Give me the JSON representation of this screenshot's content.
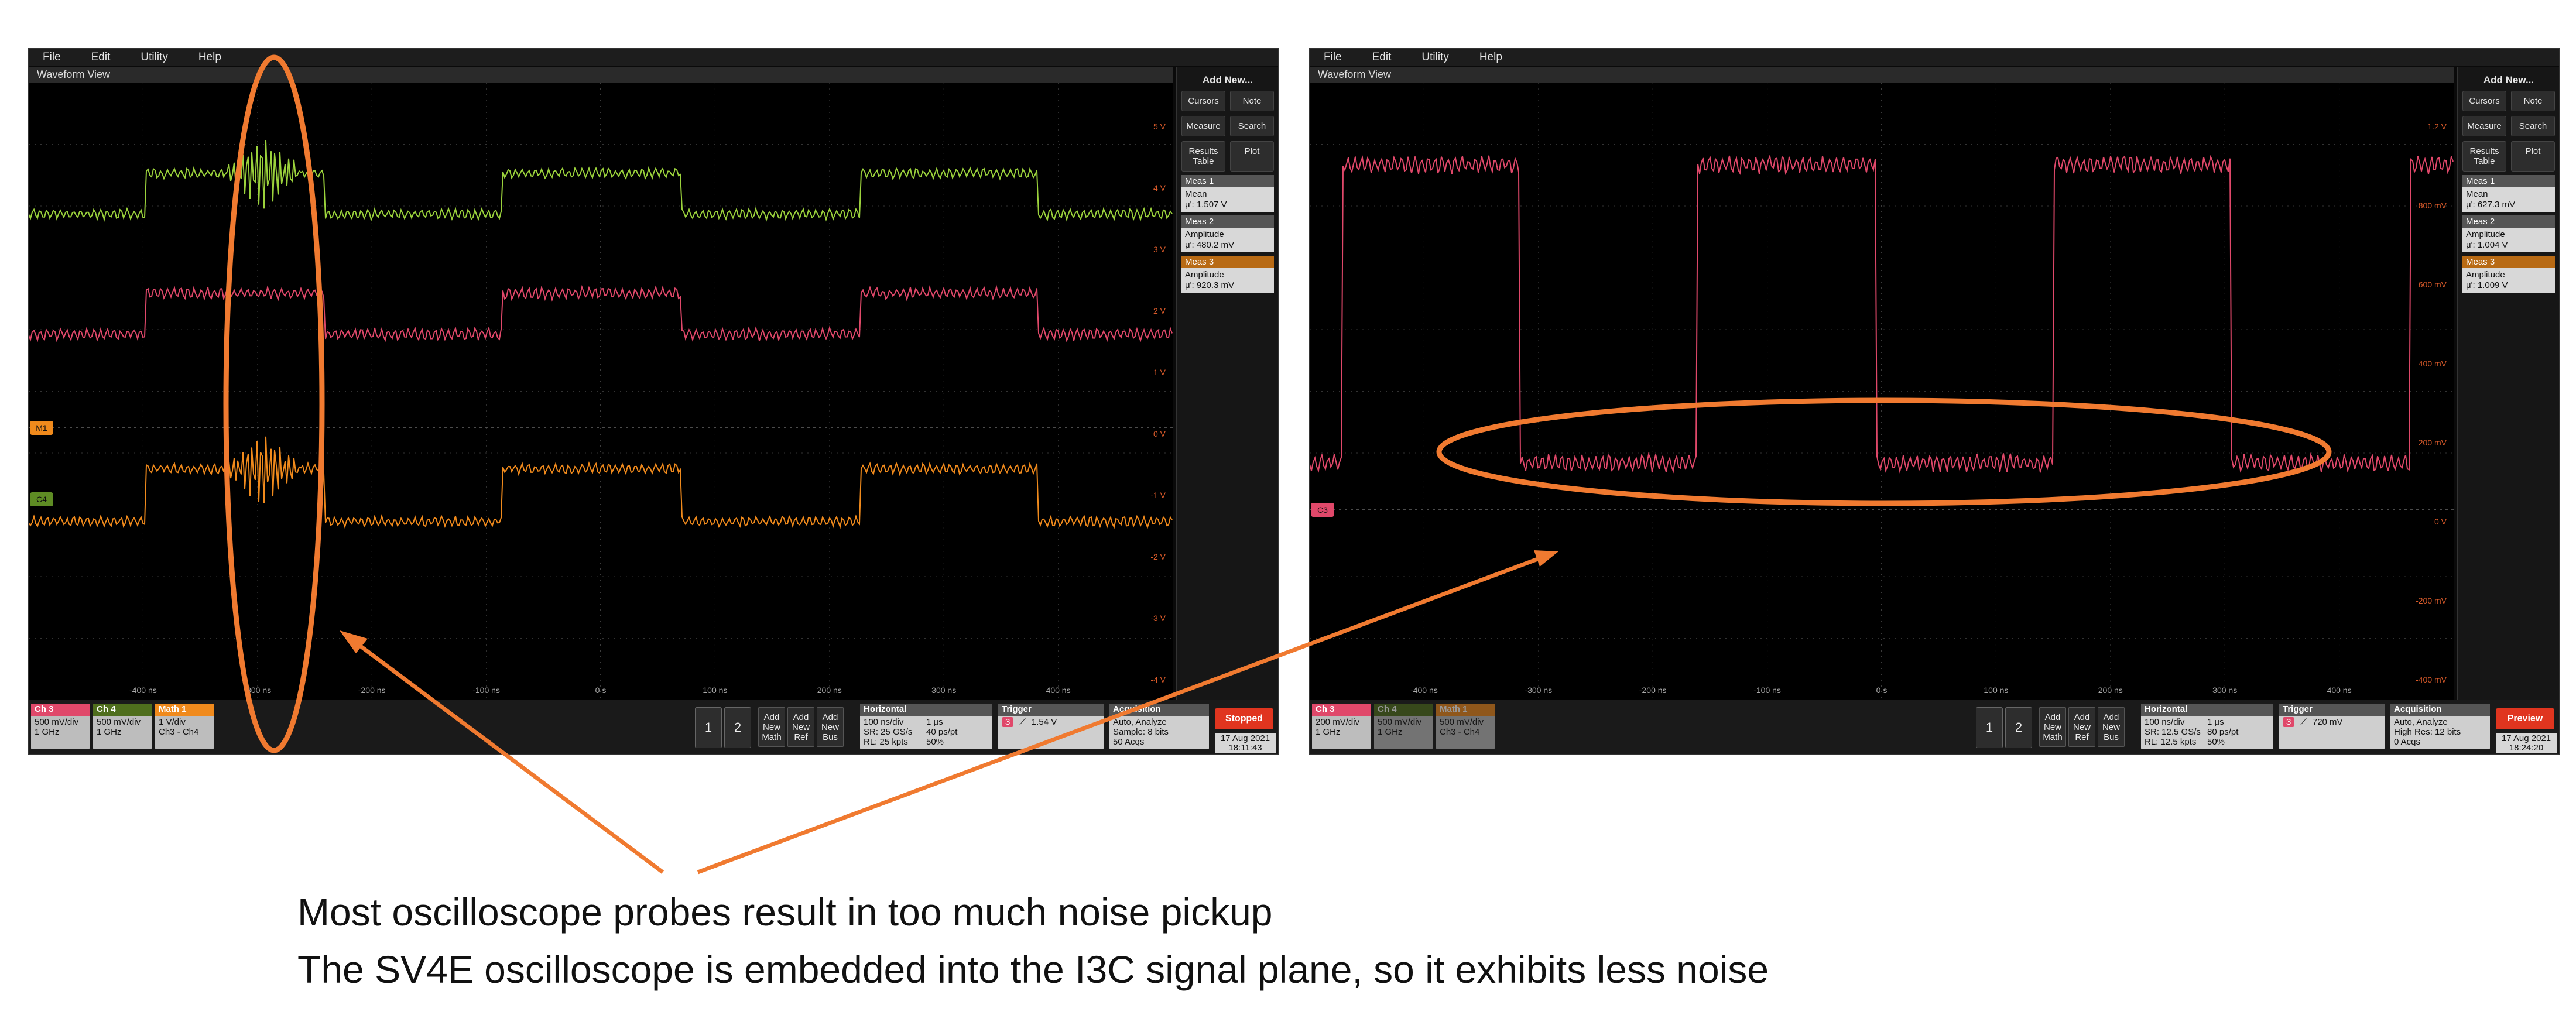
{
  "menu": [
    "File",
    "Edit",
    "Utility",
    "Help"
  ],
  "waveform_view_title": "Waveform View",
  "side_panel": {
    "title": "Add New...",
    "buttons": [
      "Cursors",
      "Note",
      "Measure",
      "Search",
      "Results Table",
      "Plot"
    ]
  },
  "left_scope": {
    "measurements": [
      {
        "header": "Meas 1",
        "name": "Mean",
        "value": "μ': 1.507 V"
      },
      {
        "header": "Meas 2",
        "name": "Amplitude",
        "value": "μ': 480.2 mV"
      },
      {
        "header": "Meas 3",
        "name": "Amplitude",
        "value": "μ': 920.3 mV"
      }
    ],
    "ylabels": [
      "5 V",
      "4 V",
      "3 V",
      "2 V",
      "1 V",
      "0 V",
      "-1 V",
      "-2 V",
      "-3 V",
      "-4 V"
    ],
    "xlabels": [
      "-400 ns",
      "-300 ns",
      "-200 ns",
      "-100 ns",
      "0 s",
      "100 ns",
      "200 ns",
      "300 ns",
      "400 ns"
    ],
    "channels": [
      {
        "name": "Ch 3",
        "l1": "500 mV/div",
        "l2": "1 GHz",
        "color": "#e0486a"
      },
      {
        "name": "Ch 4",
        "l1": "500 mV/div",
        "l2": "1 GHz",
        "color": "#9bd23c"
      },
      {
        "name": "Math 1",
        "l1": "1 V/div",
        "l2": "Ch3 - Ch4",
        "color": "#f08a1c"
      }
    ],
    "horizontal": {
      "title": "Horizontal",
      "a": "100 ns/div",
      "b": "1 µs",
      "c": "SR: 25 GS/s",
      "d": "40 ps/pt",
      "e": "RL: 25 kpts",
      "f": "50%"
    },
    "trigger": {
      "title": "Trigger",
      "ch": "3",
      "level": "1.54 V"
    },
    "acquisition": {
      "title": "Acquisition",
      "a": "Auto,",
      "b": "Analyze",
      "c": "Sample: 8 bits",
      "d": "50 Acqs"
    },
    "run_state": "Stopped",
    "date": "17 Aug 2021",
    "time": "18:11:43",
    "markers": {
      "m": "M1",
      "c": "C4"
    }
  },
  "right_scope": {
    "measurements": [
      {
        "header": "Meas 1",
        "name": "Mean",
        "value": "μ': 627.3 mV"
      },
      {
        "header": "Meas 2",
        "name": "Amplitude",
        "value": "μ': 1.004 V"
      },
      {
        "header": "Meas 3",
        "name": "Amplitude",
        "value": "μ': 1.009 V"
      }
    ],
    "ylabels": [
      "1.2 V",
      "800 mV",
      "600 mV",
      "400 mV",
      "200 mV",
      "0 V",
      "-200 mV",
      "-400 mV"
    ],
    "xlabels": [
      "-400 ns",
      "-300 ns",
      "-200 ns",
      "-100 ns",
      "0 s",
      "100 ns",
      "200 ns",
      "300 ns",
      "400 ns"
    ],
    "channels": [
      {
        "name": "Ch 3",
        "l1": "200 mV/div",
        "l2": "1 GHz",
        "color": "#e0486a"
      },
      {
        "name": "Ch 4",
        "l1": "500 mV/div",
        "l2": "1 GHz",
        "color": "#9bd23c"
      },
      {
        "name": "Math 1",
        "l1": "500 mV/div",
        "l2": "Ch3 - Ch4",
        "color": "#f08a1c"
      }
    ],
    "horizontal": {
      "title": "Horizontal",
      "a": "100 ns/div",
      "b": "1 µs",
      "c": "SR: 12.5 GS/s",
      "d": "80 ps/pt",
      "e": "RL: 12.5 kpts",
      "f": "50%"
    },
    "trigger": {
      "title": "Trigger",
      "ch": "3",
      "level": "720 mV"
    },
    "acquisition": {
      "title": "Acquisition",
      "a": "Auto,",
      "b": "Analyze",
      "c": "High Res: 12 bits",
      "d": "0 Acqs"
    },
    "run_state": "Preview",
    "date": "17 Aug 2021",
    "time": "18:24:20",
    "markers": {
      "c": "C3"
    }
  },
  "bottom_buttons": {
    "one": "1",
    "two": "2",
    "add_math": "Add New Math",
    "add_ref": "Add New Ref",
    "add_bus": "Add New Bus"
  },
  "caption": {
    "line1": "Most oscilloscope probes result in too much noise pickup",
    "line2": "The SV4E oscilloscope is embedded into the I3C signal plane, so it exhibits less noise"
  },
  "colors": {
    "annotation": "#f07a30",
    "ch3": "#e0486a",
    "ch4": "#9bd23c",
    "math": "#f08a1c"
  }
}
